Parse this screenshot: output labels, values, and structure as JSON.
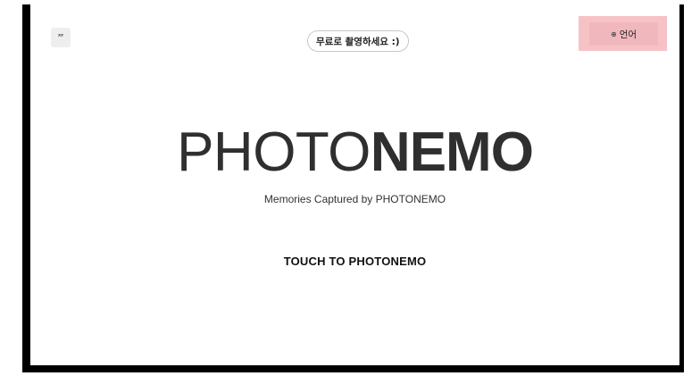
{
  "top_left_button": {
    "icon": "translate-icon",
    "glyph": "ᅏ"
  },
  "free_badge": {
    "label": "무료로 촬영하세요 :)"
  },
  "language_button": {
    "icon": "globe-icon",
    "icon_glyph": "⊕",
    "label": "언어",
    "highlight_color": "#f6c2c6"
  },
  "logo": {
    "light_part": "PHOTO",
    "bold_part": "NEMO"
  },
  "tagline": "Memories Captured by PHOTONEMO",
  "cta": "TOUCH TO PHOTONEMO",
  "colors": {
    "frame": "#000000",
    "background": "#ffffff",
    "logo": "#2f2f2f"
  }
}
